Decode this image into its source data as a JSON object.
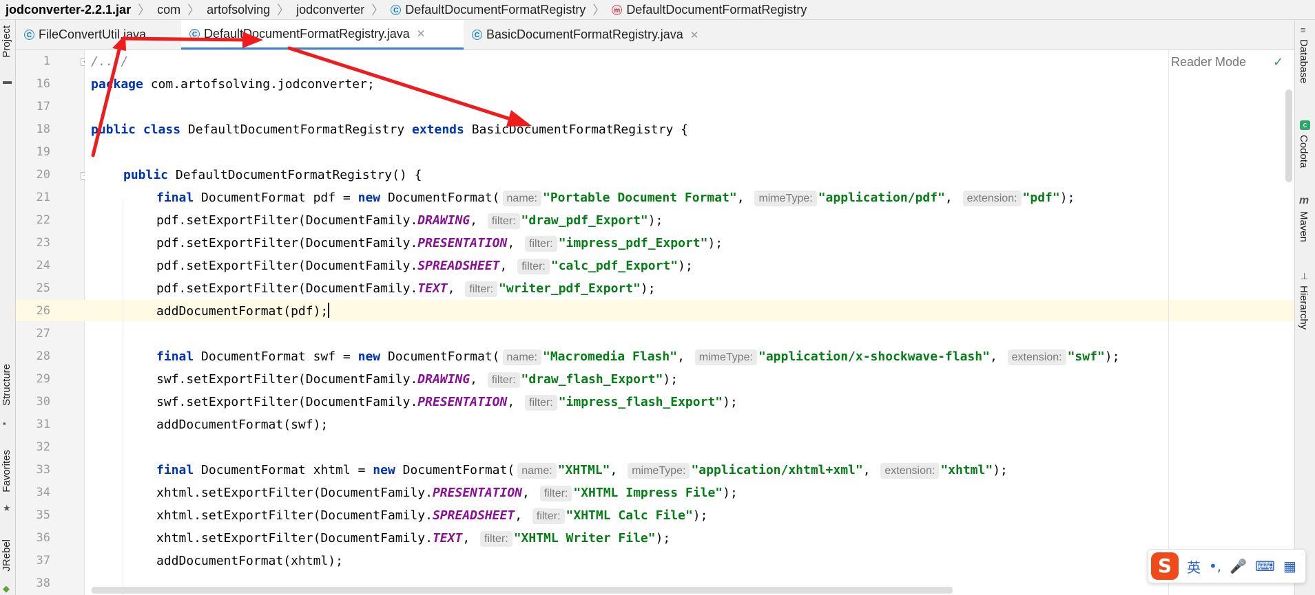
{
  "breadcrumb": {
    "jar": "jodconverter-2.2.1.jar",
    "items": [
      "com",
      "artofsolving",
      "jodconverter",
      "DefaultDocumentFormatRegistry",
      "DefaultDocumentFormatRegistry"
    ]
  },
  "tabs": [
    {
      "label": "FileConvertUtil.java",
      "active": false
    },
    {
      "label": "DefaultDocumentFormatRegistry.java",
      "active": true
    },
    {
      "label": "BasicDocumentFormatRegistry.java",
      "active": false
    }
  ],
  "left_toolbar": {
    "project": "Project",
    "structure": "Structure",
    "favorites": "Favorites",
    "jrebel": "JRebel"
  },
  "right_toolbar": {
    "database": "Database",
    "codota": "Codota",
    "maven": "Maven",
    "hierarchy": "Hierarchy"
  },
  "editor": {
    "reader_mode": "Reader Mode",
    "line_numbers": [
      "1",
      "16",
      "17",
      "18",
      "19",
      "20",
      "21",
      "22",
      "23",
      "24",
      "25",
      "26",
      "27",
      "28",
      "29",
      "30",
      "31",
      "32",
      "33",
      "34",
      "35",
      "36",
      "37",
      "38"
    ],
    "code": {
      "l1_comment": "/.../",
      "l16_kw": "package",
      "l16_rest": " com.artofsolving.jodconverter;",
      "l18_kw1": "public class",
      "l18_name": " DefaultDocumentFormatRegistry ",
      "l18_kw2": "extends",
      "l18_rest": " BasicDocumentFormatRegistry {",
      "l20_kw": "public",
      "l20_rest": " DefaultDocumentFormatRegistry() {",
      "kw_final": "final",
      "kw_new": "new",
      "doc_format": " DocumentFormat ",
      "doc_format_call": " DocumentFormat(",
      "hint_name": "name:",
      "hint_mime": "mimeType:",
      "hint_ext": "extension:",
      "hint_filter": "filter:",
      "comma": ", ",
      "close": ");",
      "l21_var": "pdf = ",
      "l21_s1": "\"Portable Document Format\"",
      "l21_s2": "\"application/pdf\"",
      "l21_s3": "\"pdf\"",
      "pdf_call": "pdf.setExportFilter(DocumentFamily.",
      "c_drawing": "DRAWING",
      "c_presentation": "PRESENTATION",
      "c_spreadsheet": "SPREADSHEET",
      "c_text": "TEXT",
      "l22_s": "\"draw_pdf_Export\"",
      "l23_s": "\"impress_pdf_Export\"",
      "l24_s": "\"calc_pdf_Export\"",
      "l25_s": "\"writer_pdf_Export\"",
      "l26": "addDocumentFormat(pdf);",
      "l28_var": "swf = ",
      "l28_s1": "\"Macromedia Flash\"",
      "l28_s2": "\"application/x-shockwave-flash\"",
      "l28_s3": "\"swf\"",
      "swf_call": "swf.setExportFilter(DocumentFamily.",
      "l29_s": "\"draw_flash_Export\"",
      "l30_s": "\"impress_flash_Export\"",
      "l31": "addDocumentFormat(swf);",
      "l33_var": "xhtml = ",
      "l33_s1": "\"XHTML\"",
      "l33_s2": "\"application/xhtml+xml\"",
      "l33_s3": "\"xhtml\"",
      "xhtml_call": "xhtml.setExportFilter(DocumentFamily.",
      "l34_s": "\"XHTML Impress File\"",
      "l35_s": "\"XHTML Calc File\"",
      "l36_s": "\"XHTML Writer File\"",
      "l37": "addDocumentFormat(xhtml);"
    }
  },
  "ime": {
    "logo": "S",
    "lang": "英",
    "punct": "•,",
    "mic": "🎤",
    "keyboard": "⌨",
    "apps": "▦"
  },
  "colors": {
    "keyword": "#0033b3",
    "string": "#067d17",
    "constant": "#871094",
    "tab_active": "#4083c9",
    "annotation_arrow": "#ee1c1c"
  }
}
